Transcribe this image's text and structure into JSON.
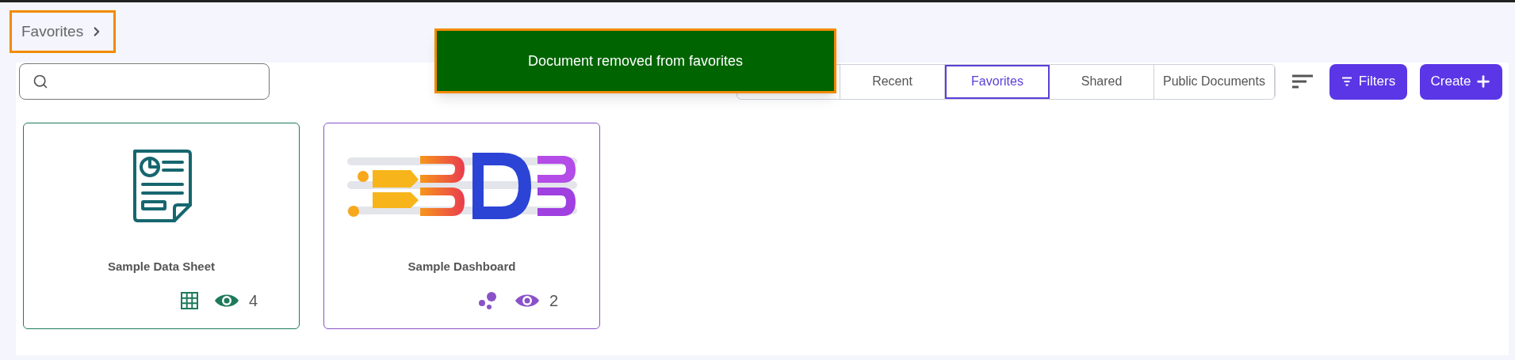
{
  "breadcrumb": {
    "label": "Favorites"
  },
  "toast": {
    "message": "Document removed from favorites"
  },
  "tabs": [
    {
      "label": "Recent",
      "selected": false
    },
    {
      "label": "Favorites",
      "selected": true
    },
    {
      "label": "Shared",
      "selected": false
    },
    {
      "label": "Public Documents",
      "selected": false
    }
  ],
  "buttons": {
    "filters": "Filters",
    "create": "Create"
  },
  "cards": [
    {
      "kind": "datasheet",
      "title": "Sample Data Sheet",
      "views": "4",
      "color": "#1e7a5a"
    },
    {
      "kind": "dashboard",
      "title": "Sample Dashboard",
      "views": "2",
      "color": "#8a52c8"
    }
  ]
}
